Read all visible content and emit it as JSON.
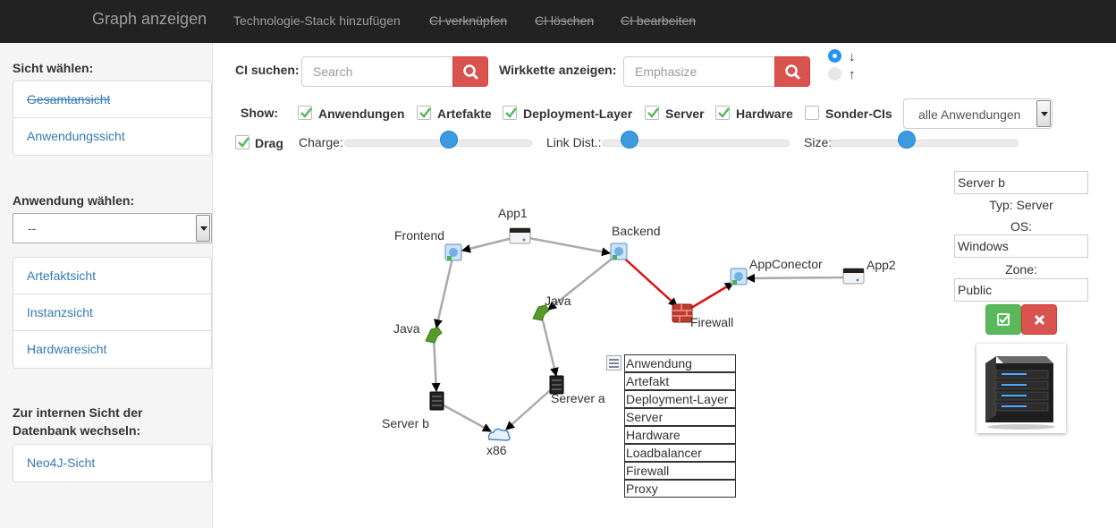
{
  "navbar": {
    "brand": "Graph anzeigen",
    "links": [
      {
        "label": "Technologie-Stack hinzufügen",
        "strikethrough": false
      },
      {
        "label": "CI verknüpfen",
        "strikethrough": true
      },
      {
        "label": "CI löschen",
        "strikethrough": true
      },
      {
        "label": "CI bearbeiten",
        "strikethrough": true
      }
    ]
  },
  "sidebar": {
    "view_label": "Sicht wählen:",
    "views": [
      {
        "label": "Gesamtansicht",
        "strikethrough": true
      },
      {
        "label": "Anwendungssicht",
        "strikethrough": false
      }
    ],
    "app_label": "Anwendung wählen:",
    "app_select_value": "--",
    "subviews": [
      {
        "label": "Artefaktsicht"
      },
      {
        "label": "Instanzsicht"
      },
      {
        "label": "Hardwaresicht"
      }
    ],
    "internal_label": "Zur internen Sicht der Datenbank wechseln:",
    "internal_link": "Neo4J-Sicht"
  },
  "toolbar": {
    "ci_search_label": "CI suchen:",
    "ci_search_placeholder": "Search",
    "chain_label": "Wirkkette anzeigen:",
    "chain_placeholder": "Emphasize",
    "direction": {
      "down": "↓",
      "up": "↑",
      "selected": "down"
    },
    "show_label": "Show:",
    "filters": [
      {
        "label": "Anwendungen",
        "checked": true
      },
      {
        "label": "Artefakte",
        "checked": true
      },
      {
        "label": "Deployment-Layer",
        "checked": true
      },
      {
        "label": "Server",
        "checked": true
      },
      {
        "label": "Hardware",
        "checked": true
      },
      {
        "label": "Sonder-CIs",
        "checked": false
      }
    ],
    "app_filter_value": "alle Anwendungen",
    "drag_label": "Drag",
    "drag_checked": true,
    "sliders": [
      {
        "label": "Charge:",
        "value_fraction": 0.55
      },
      {
        "label": "Link Dist.:",
        "value_fraction": 0.15
      },
      {
        "label": "Size:",
        "value_fraction": 0.4
      }
    ]
  },
  "graph": {
    "nodes": [
      {
        "id": "app1",
        "label": "App1",
        "kind": "application"
      },
      {
        "id": "frontend",
        "label": "Frontend",
        "kind": "artifact"
      },
      {
        "id": "backend",
        "label": "Backend",
        "kind": "artifact"
      },
      {
        "id": "java1",
        "label": "Java",
        "kind": "deployment-layer"
      },
      {
        "id": "java2",
        "label": "Java",
        "kind": "deployment-layer"
      },
      {
        "id": "firewall",
        "label": "Firewall",
        "kind": "firewall"
      },
      {
        "id": "appconector",
        "label": "AppConector",
        "kind": "artifact"
      },
      {
        "id": "app2",
        "label": "App2",
        "kind": "application"
      },
      {
        "id": "serverb",
        "label": "Server b",
        "kind": "server"
      },
      {
        "id": "serevera",
        "label": "Serever a",
        "kind": "server"
      },
      {
        "id": "x86",
        "label": "x86",
        "kind": "hardware"
      }
    ],
    "edges": [
      {
        "from": "app1",
        "to": "frontend",
        "highlight": false
      },
      {
        "from": "app1",
        "to": "backend",
        "highlight": false
      },
      {
        "from": "frontend",
        "to": "java1",
        "highlight": false
      },
      {
        "from": "java1",
        "to": "serverb",
        "highlight": false
      },
      {
        "from": "serverb",
        "to": "x86",
        "highlight": false
      },
      {
        "from": "backend",
        "to": "java2",
        "highlight": false
      },
      {
        "from": "java2",
        "to": "serevera",
        "highlight": false
      },
      {
        "from": "serevera",
        "to": "x86",
        "highlight": false
      },
      {
        "from": "backend",
        "to": "firewall",
        "highlight": true
      },
      {
        "from": "firewall",
        "to": "appconector",
        "highlight": true
      },
      {
        "from": "app2",
        "to": "appconector",
        "highlight": false
      }
    ],
    "legend": [
      "Anwendung",
      "Artefakt",
      "Deployment-Layer",
      "Server",
      "Hardware",
      "Loadbalancer",
      "Firewall",
      "Proxy"
    ]
  },
  "details": {
    "name": "Server b",
    "type_text": "Typ: Server",
    "os_label": "OS:",
    "os_value": "Windows",
    "zone_label": "Zone:",
    "zone_value": "Public"
  },
  "colors": {
    "navbar": "#222222",
    "danger": "#d9534f",
    "success": "#5cb85c",
    "link": "#337ab7",
    "highlight_edge": "#dd1111",
    "edge": "#aaaaaa"
  }
}
